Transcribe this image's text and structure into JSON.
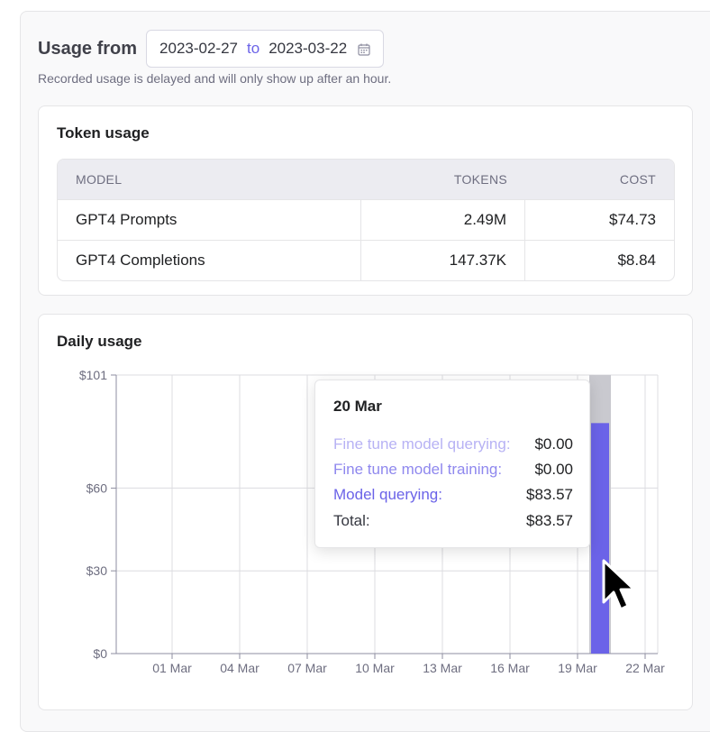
{
  "header": {
    "usage_from": "Usage from",
    "start_date": "2023-02-27",
    "to": "to",
    "end_date": "2023-03-22",
    "delay_note": "Recorded usage is delayed and will only show up after an hour."
  },
  "token_usage": {
    "title": "Token usage",
    "columns": [
      "MODEL",
      "TOKENS",
      "COST"
    ],
    "rows": [
      {
        "model": "GPT4 Prompts",
        "tokens": "2.49M",
        "cost": "$74.73"
      },
      {
        "model": "GPT4 Completions",
        "tokens": "147.37K",
        "cost": "$8.84"
      }
    ]
  },
  "daily_usage": {
    "title": "Daily usage",
    "tooltip": {
      "date": "20 Mar",
      "rows": [
        {
          "label": "Fine tune model querying:",
          "value": "$0.00",
          "color": "#b7b2f4"
        },
        {
          "label": "Fine tune model training:",
          "value": "$0.00",
          "color": "#8f88ee"
        },
        {
          "label": "Model querying:",
          "value": "$83.57",
          "color": "#6b63e8"
        },
        {
          "label": "Total:",
          "value": "$83.57",
          "color": "#353740"
        }
      ]
    }
  },
  "chart_data": {
    "type": "bar",
    "x_tick_labels": [
      "01 Mar",
      "04 Mar",
      "07 Mar",
      "10 Mar",
      "13 Mar",
      "16 Mar",
      "19 Mar",
      "22 Mar"
    ],
    "y_tick_labels": [
      "$101",
      "$60",
      "$30",
      "$0"
    ],
    "y_ticks": [
      101,
      60,
      30,
      0
    ],
    "ylim": [
      0,
      101
    ],
    "x_range_days": [
      "2023-02-27",
      "2023-03-22"
    ],
    "series": [
      {
        "name": "Fine tune model querying",
        "color": "#b7b2f4",
        "points": [
          {
            "date": "2023-03-20",
            "value": 0
          }
        ]
      },
      {
        "name": "Fine tune model training",
        "color": "#8f88ee",
        "points": [
          {
            "date": "2023-03-20",
            "value": 0
          }
        ]
      },
      {
        "name": "Model querying",
        "color": "#6b63e8",
        "points": [
          {
            "date": "2023-03-20",
            "value": 83.57
          }
        ]
      }
    ],
    "highlighted_date": "2023-03-20",
    "grid": true
  }
}
